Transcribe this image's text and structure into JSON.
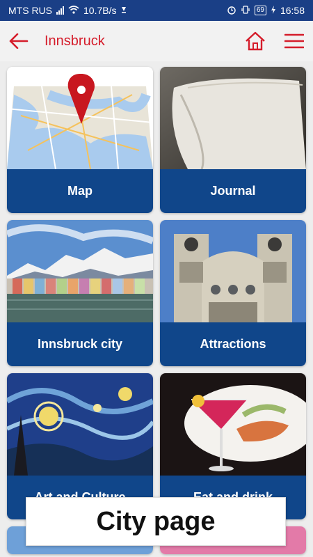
{
  "status": {
    "carrier": "MTS RUS",
    "speed": "10.7B/s",
    "battery": "69",
    "time": "16:58"
  },
  "toolbar": {
    "title": "Innsbruck",
    "back_icon": "back-arrow-icon",
    "home_icon": "home-icon",
    "menu_icon": "menu-icon"
  },
  "cards": [
    {
      "label": "Map",
      "image": "map-image"
    },
    {
      "label": "Journal",
      "image": "journal-image"
    },
    {
      "label": "Innsbruck city",
      "image": "city-image"
    },
    {
      "label": "Attractions",
      "image": "church-image"
    },
    {
      "label": "Art and Culture",
      "image": "starry-night-image"
    },
    {
      "label": "Eat and drink",
      "image": "food-drink-image"
    }
  ],
  "banner": {
    "text": "City page"
  },
  "colors": {
    "accent": "#d51d2b",
    "card_label_bg": "#10468a",
    "status_bar": "#1a3f86"
  }
}
